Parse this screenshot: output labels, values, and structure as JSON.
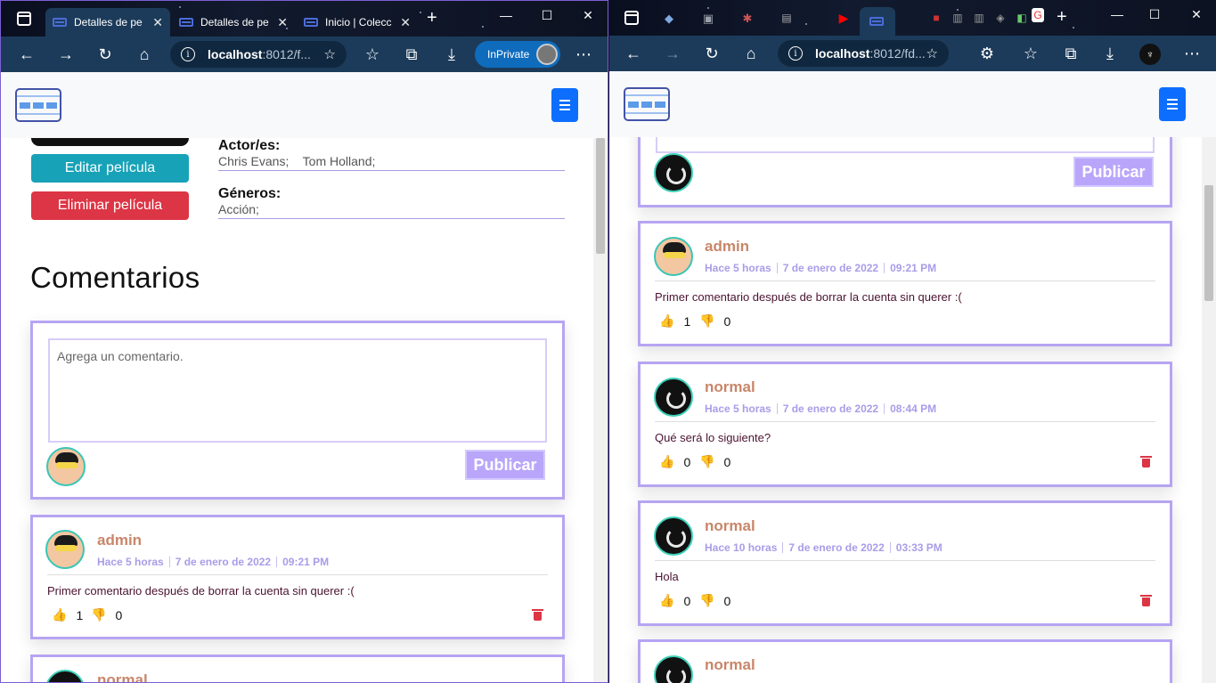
{
  "left": {
    "tabs": [
      {
        "label": "Detalles de pe"
      },
      {
        "label": "Detalles de pe"
      },
      {
        "label": "Inicio | Colecc"
      }
    ],
    "url_host": "localhost",
    "url_rest": ":8012/f...",
    "inprivate_label": "InPrivate",
    "buttons": {
      "edit": "Editar película",
      "delete": "Eliminar película"
    },
    "actors_label": "Actor/es:",
    "actors_value": "Chris Evans;    Tom Holland;",
    "genres_label": "Géneros:",
    "genres_value": "Acción;",
    "comments_heading": "Comentarios",
    "comment_placeholder": "Agrega un comentario.",
    "publish_label": "Publicar",
    "comments": [
      {
        "user": "admin",
        "ago": "Hace 5 horas",
        "date": "7 de enero de 2022",
        "time": "09:21 PM",
        "text": "Primer comentario después de borrar la cuenta sin querer :(",
        "likes": "1",
        "dislikes": "0"
      },
      {
        "user": "normal"
      }
    ]
  },
  "right": {
    "url_host": "localhost",
    "url_rest": ":8012/fd...",
    "publish_label": "Publicar",
    "comments": [
      {
        "user": "admin",
        "ago": "Hace 5 horas",
        "date": "7 de enero de 2022",
        "time": "09:21 PM",
        "text": "Primer comentario después de borrar la cuenta sin querer :(",
        "likes": "1",
        "dislikes": "0"
      },
      {
        "user": "normal",
        "ago": "Hace 5 horas",
        "date": "7 de enero de 2022",
        "time": "08:44 PM",
        "text": "Qué será lo siguiente?",
        "likes": "0",
        "dislikes": "0"
      },
      {
        "user": "normal",
        "ago": "Hace 10 horas",
        "date": "7 de enero de 2022",
        "time": "03:33 PM",
        "text": "Hola",
        "likes": "0",
        "dislikes": "0"
      },
      {
        "user": "normal"
      }
    ]
  },
  "colors": {
    "primary": "#0d6efd",
    "edit": "#17a2b8",
    "delete": "#dc3545",
    "card_border": "#b7a4f2",
    "username": "#c8866a",
    "meta": "#a89de8"
  }
}
